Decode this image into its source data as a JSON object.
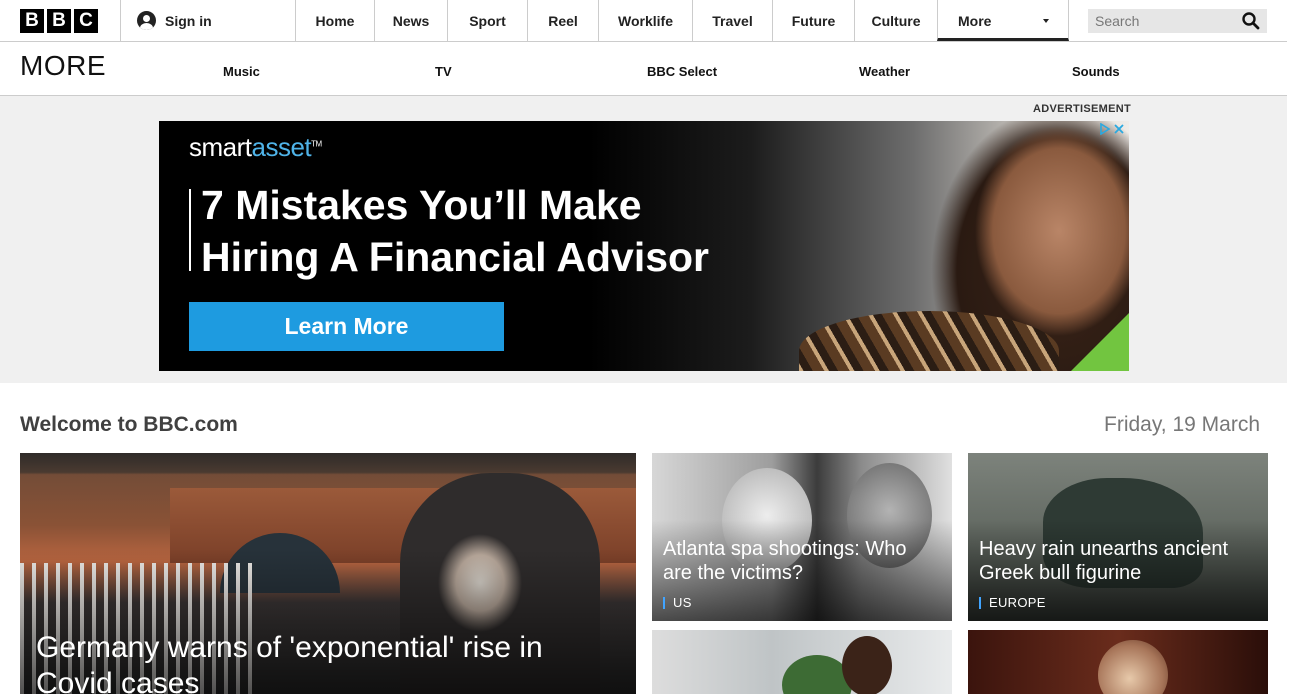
{
  "header": {
    "logo_letters": [
      "B",
      "B",
      "C"
    ],
    "signin_label": "Sign in",
    "nav": [
      {
        "label": "Home",
        "name": "nav-home"
      },
      {
        "label": "News",
        "name": "nav-news"
      },
      {
        "label": "Sport",
        "name": "nav-sport"
      },
      {
        "label": "Reel",
        "name": "nav-reel"
      },
      {
        "label": "Worklife",
        "name": "nav-worklife"
      },
      {
        "label": "Travel",
        "name": "nav-travel"
      },
      {
        "label": "Future",
        "name": "nav-future"
      },
      {
        "label": "Culture",
        "name": "nav-culture"
      }
    ],
    "more_label": "More",
    "search_placeholder": "Search"
  },
  "more_panel": {
    "title": "MORE",
    "links": [
      "Music",
      "TV",
      "BBC Select",
      "Weather",
      "Sounds"
    ]
  },
  "ad": {
    "label": "ADVERTISEMENT",
    "brand_prefix": "smart",
    "brand_suffix": "asset",
    "brand_tm": "TM",
    "headline": "7 Mistakes You’ll Make Hiring A Financial Advisor",
    "cta": "Learn More",
    "choices_icons": [
      "adchoices-icon",
      "close-icon"
    ],
    "colors": {
      "brand_blue": "#1e9be0",
      "accent_green": "#72c540"
    }
  },
  "main": {
    "welcome": "Welcome to BBC.com",
    "date": "Friday, 19 March",
    "hero": {
      "headline": "Germany warns of 'exponential' rise in Covid cases"
    },
    "cards": [
      {
        "headline": "Atlanta spa shootings: Who are the victims?",
        "tag": "US"
      },
      {
        "headline": "Heavy rain unearths ancient Greek bull figurine",
        "tag": "EUROPE"
      }
    ],
    "tag_color": "#41a4ff"
  }
}
